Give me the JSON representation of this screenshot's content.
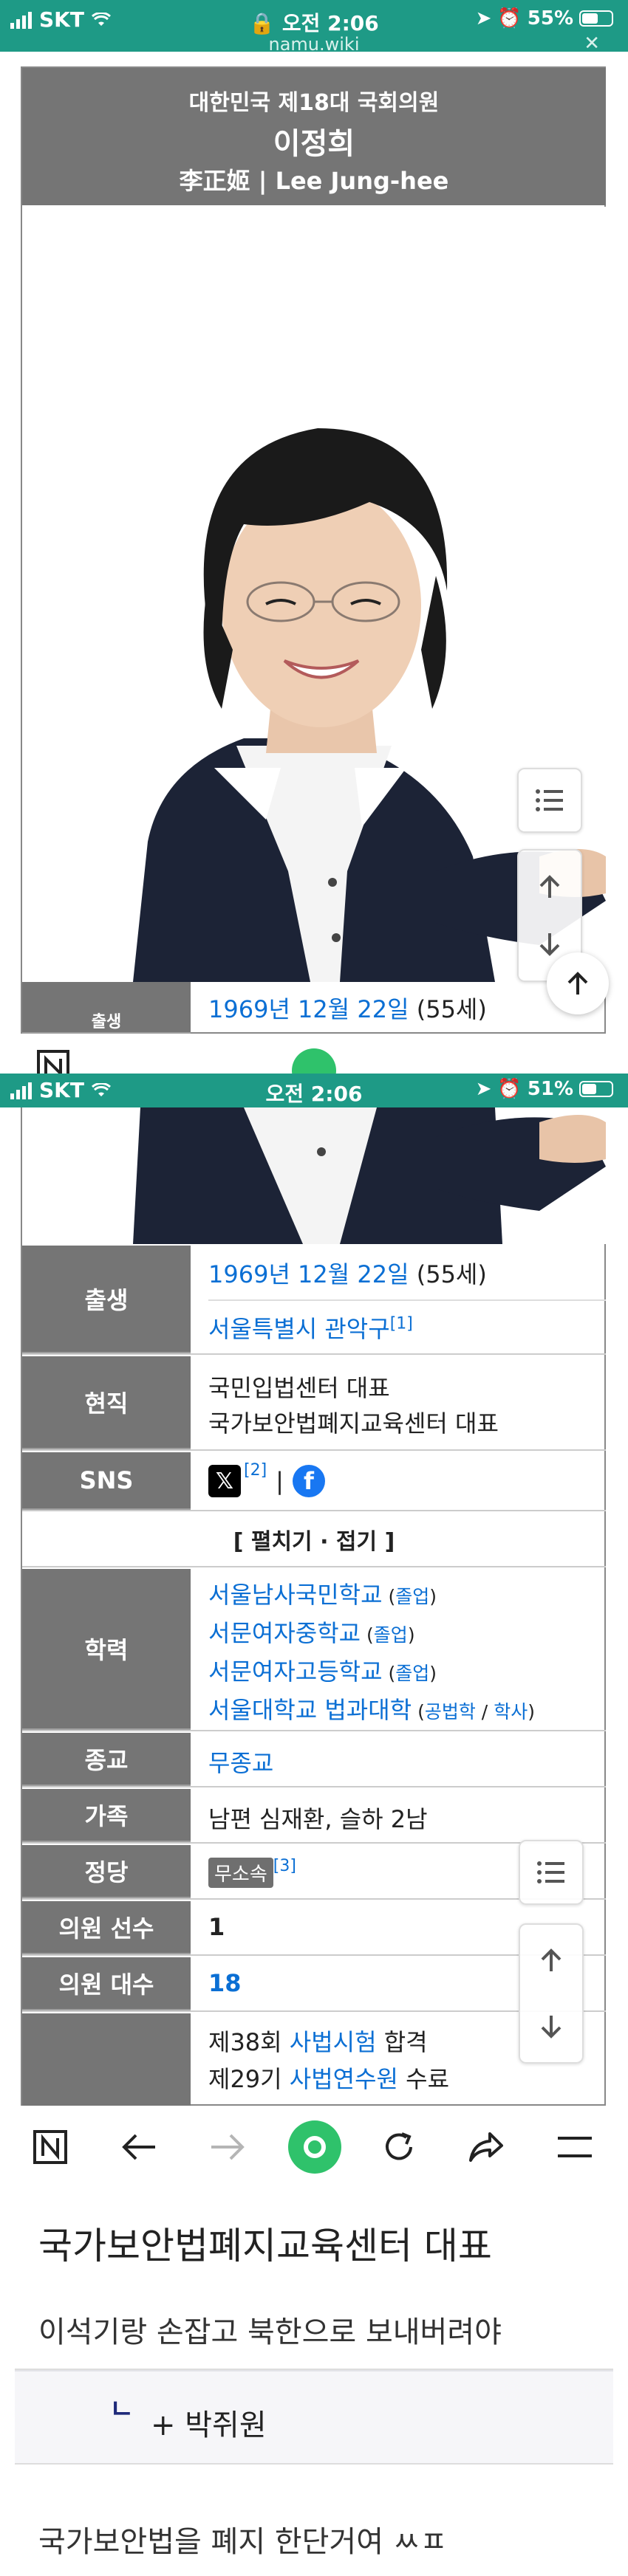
{
  "status_top": {
    "carrier": "SKT",
    "time": "오전 2:06",
    "battery": "55%",
    "battery_level": 0.55,
    "url": "namu.wiki"
  },
  "status_bottom": {
    "carrier": "SKT",
    "time": "오전 2:06",
    "battery": "51%",
    "battery_level": 0.51
  },
  "infobox": {
    "subtitle": "대한민국 제18대 국회의원",
    "name": "이정희",
    "name_alt": "李正姬 | Lee Jung-hee",
    "photo_alt": "portrait"
  },
  "peek_row": {
    "date": "1969년 12월 22일",
    "age": "(55세)",
    "label_fragment": "출생"
  },
  "rows": {
    "birth": {
      "label": "출생",
      "date": "1969년 12월 22일",
      "age": "(55세)",
      "place": "서울특별시 관악구",
      "place_ref": "[1]"
    },
    "current": {
      "label": "현직",
      "line1": "국민입법센터 대표",
      "line2": "국가보안법폐지교육센터 대표"
    },
    "sns": {
      "label": "SNS",
      "ref": "[2]",
      "sep": "|"
    },
    "toggle": "[ 펼치기 · 접기 ]",
    "education": {
      "label": "학력",
      "items": [
        {
          "school": "서울남사국민학교",
          "note_open": " (",
          "note": "졸업",
          "note_close": ")"
        },
        {
          "school": "서문여자중학교",
          "note_open": " (",
          "note": "졸업",
          "note_close": ")"
        },
        {
          "school": "서문여자고등학교",
          "note_open": " (",
          "note": "졸업",
          "note_close": ")"
        },
        {
          "school": "서울대학교 법과대학",
          "note_open": " (",
          "note": "공법학",
          "note_sep": " / ",
          "note2": "학사",
          "note_close": ")"
        }
      ]
    },
    "religion": {
      "label": "종교",
      "value": "무종교"
    },
    "family": {
      "label": "가족",
      "value": "남편 심재환, 슬하 2남"
    },
    "party": {
      "label": "정당",
      "value": "무소속",
      "ref": "[3]"
    },
    "terms": {
      "label": "의원 선수",
      "value": "1"
    },
    "assembly": {
      "label": "의원 대수",
      "value": "18"
    },
    "career": {
      "line1_pre": "제38회 ",
      "line1_link": "사법시험",
      "line1_post": " 합격",
      "line2_pre": "제29기 ",
      "line2_link": "사법연수원",
      "line2_post": " 수료"
    }
  },
  "comments": {
    "title": "국가보안법폐지교육센터 대표",
    "text1": "이석기랑 손잡고 북한으로 보내버려야",
    "reply": "+ 박쥐원",
    "reply_mark": "ㄴ",
    "text2": "국가보안법을 폐지 한단거여 ㅆㅍ"
  },
  "colors": {
    "status_bg": "#1e9a86",
    "label_bg": "#757575",
    "link": "#0b6fd4",
    "active_green": "#2fc26b"
  },
  "icons": [
    "toc-icon",
    "arrow-up-icon",
    "arrow-down-icon",
    "back-icon",
    "forward-icon",
    "home-icon",
    "reload-icon",
    "share-icon",
    "menu-icon",
    "x-logo-icon",
    "facebook-icon",
    "wifi-icon",
    "battery-icon",
    "lock-icon",
    "location-icon",
    "alarm-icon"
  ]
}
